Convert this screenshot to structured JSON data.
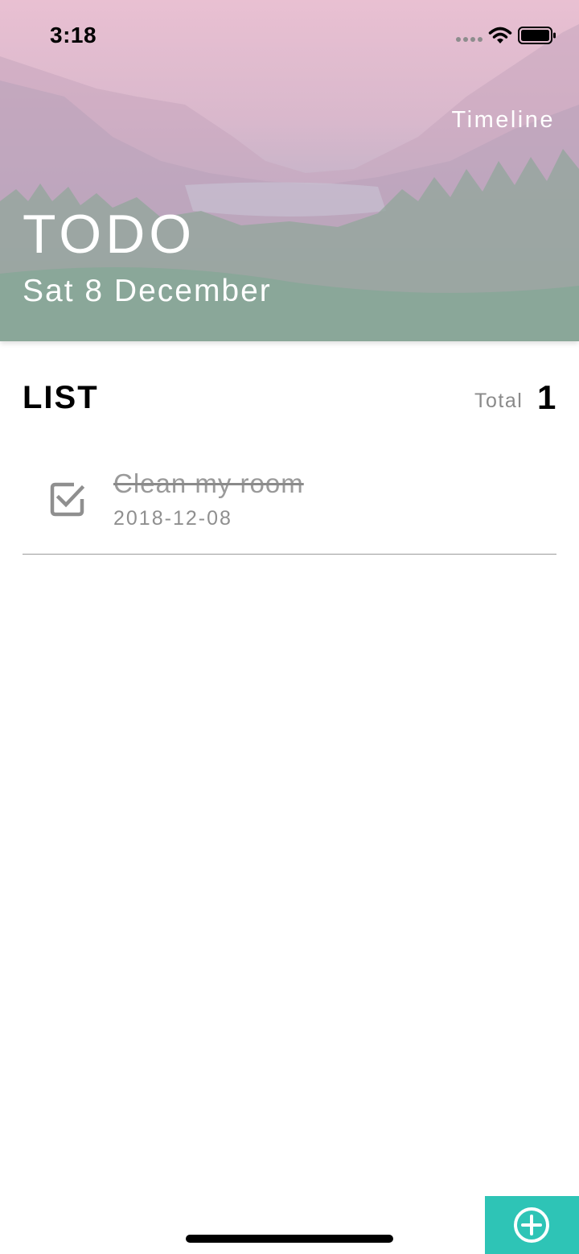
{
  "status_bar": {
    "time": "3:18"
  },
  "header": {
    "nav_link": "Timeline",
    "title": "TODO",
    "date": "Sat 8 December",
    "overlay_color": "#e9c0d2"
  },
  "list": {
    "heading": "LIST",
    "total_label": "Total",
    "total_count": "1",
    "items": [
      {
        "title": "Clean my room",
        "date": "2018-12-08",
        "completed": true
      }
    ]
  },
  "fab": {
    "icon": "add-circle-icon",
    "color": "#2ec4b6"
  },
  "colors": {
    "accent": "#2ec4b6",
    "muted_text": "#8a8a8a"
  }
}
